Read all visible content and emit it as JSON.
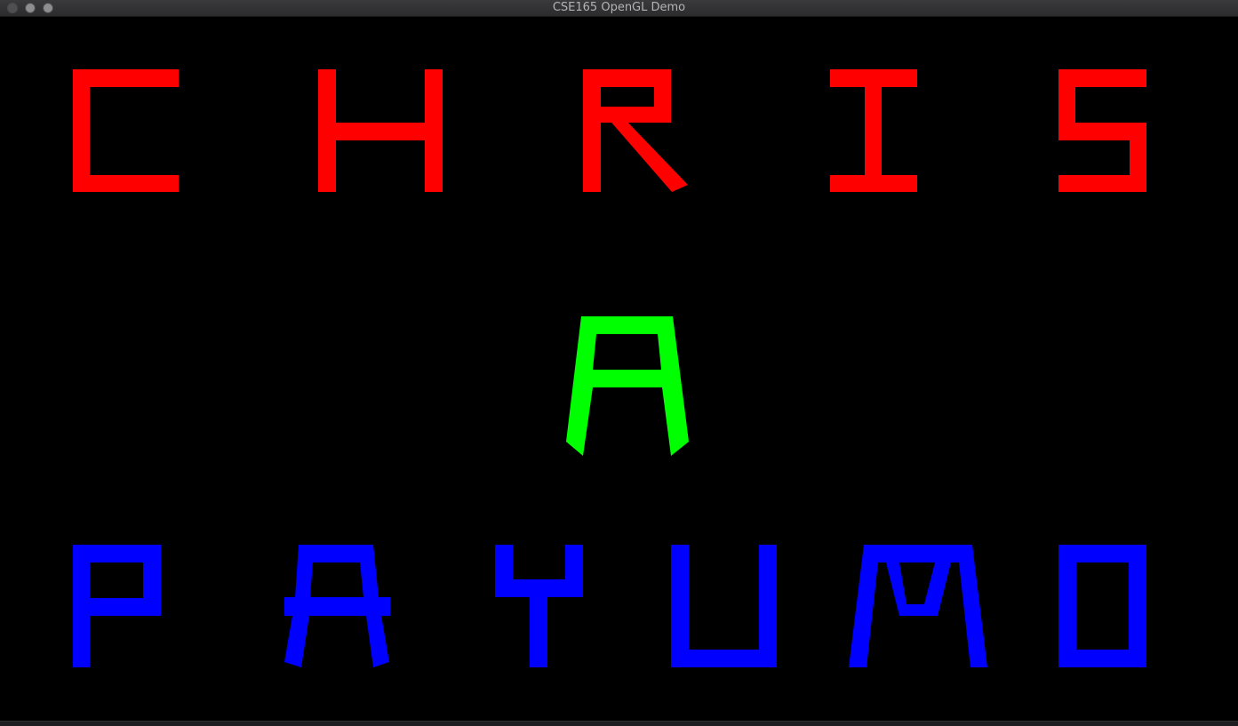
{
  "window": {
    "title": "CSE165 OpenGL Demo"
  },
  "scene": {
    "rows": [
      {
        "name": "first-name",
        "text": "CHRIS",
        "color": "#ff0000",
        "letters": [
          "C",
          "H",
          "R",
          "I",
          "S"
        ]
      },
      {
        "name": "middle-initial",
        "text": "A",
        "color": "#00ff00",
        "letters": [
          "A"
        ]
      },
      {
        "name": "last-name",
        "text": "PAYUMO",
        "color": "#0000ff",
        "letters": [
          "P",
          "A",
          "Y",
          "U",
          "M",
          "O"
        ]
      }
    ]
  },
  "colors": {
    "background": "#000000",
    "titlebar": "#2c2c2e",
    "title_text": "#b3b3b5"
  }
}
